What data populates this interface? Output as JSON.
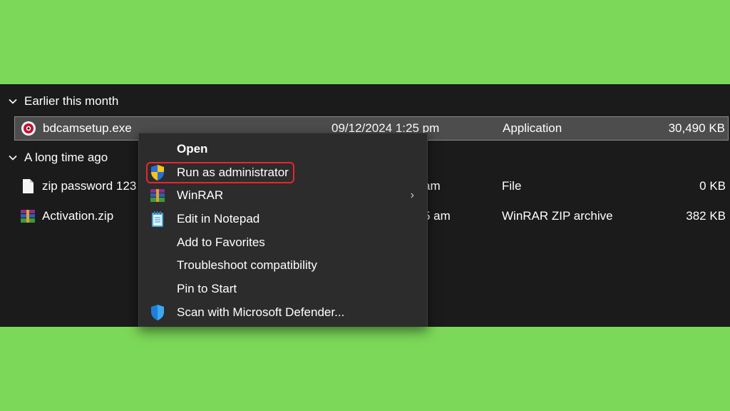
{
  "groups": {
    "earlier": "Earlier this month",
    "long_ago": "A long time ago"
  },
  "files": [
    {
      "name": "bdcamsetup.exe",
      "date": "09/12/2024 1:25 pm",
      "type": "Application",
      "size": "30,490 KB",
      "icon": "bandicam-app-icon"
    },
    {
      "name": "zip password 123",
      "date": "am",
      "type": "File",
      "size": "0 KB",
      "icon": "blank-file-icon"
    },
    {
      "name": "Activation.zip",
      "date": "5 am",
      "type": "WinRAR ZIP archive",
      "size": "382 KB",
      "icon": "winrar-archive-icon"
    }
  ],
  "context_menu": {
    "items": [
      {
        "label": "Open",
        "icon": ""
      },
      {
        "label": "Run as administrator",
        "icon": "uac-shield-icon"
      },
      {
        "label": "WinRAR",
        "icon": "winrar-icon",
        "submenu": "›"
      },
      {
        "label": "Edit in Notepad",
        "icon": "notepad-icon"
      },
      {
        "label": "Add to Favorites",
        "icon": ""
      },
      {
        "label": "Troubleshoot compatibility",
        "icon": ""
      },
      {
        "label": "Pin to Start",
        "icon": ""
      },
      {
        "label": "Scan with Microsoft Defender...",
        "icon": "defender-shield-icon"
      }
    ]
  },
  "colors": {
    "background": "#7cd858",
    "explorer_bg": "#1b1b1b",
    "menu_bg": "#2c2c2c",
    "highlight": "#e8262c"
  }
}
